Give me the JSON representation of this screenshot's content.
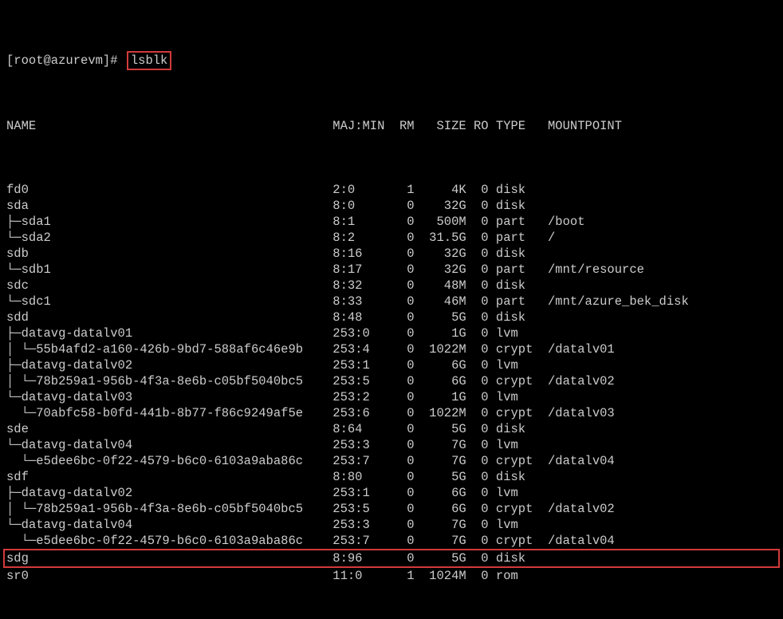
{
  "prompt_user_host": "[root@azurevm]#",
  "command": "lsblk",
  "headers": {
    "name": "NAME",
    "majmin": "MAJ:MIN",
    "rm": "RM",
    "size": "SIZE",
    "ro": "RO",
    "type": "TYPE",
    "mountpoint": "MOUNTPOINT"
  },
  "rows": [
    {
      "indent_class": "level0",
      "name": "fd0",
      "majmin": "2:0",
      "rm": "1",
      "size": "4K",
      "ro": "0",
      "type": "disk",
      "mount": ""
    },
    {
      "indent_class": "level0",
      "name": "sda",
      "majmin": "8:0",
      "rm": "0",
      "size": "32G",
      "ro": "0",
      "type": "disk",
      "mount": ""
    },
    {
      "indent_class": "level1",
      "name": "sda1",
      "majmin": "8:1",
      "rm": "0",
      "size": "500M",
      "ro": "0",
      "type": "part",
      "mount": "/boot"
    },
    {
      "indent_class": "level1-last",
      "name": "sda2",
      "majmin": "8:2",
      "rm": "0",
      "size": "31.5G",
      "ro": "0",
      "type": "part",
      "mount": "/"
    },
    {
      "indent_class": "level0",
      "name": "sdb",
      "majmin": "8:16",
      "rm": "0",
      "size": "32G",
      "ro": "0",
      "type": "disk",
      "mount": ""
    },
    {
      "indent_class": "level1-last",
      "name": "sdb1",
      "majmin": "8:17",
      "rm": "0",
      "size": "32G",
      "ro": "0",
      "type": "part",
      "mount": "/mnt/resource"
    },
    {
      "indent_class": "level0",
      "name": "sdc",
      "majmin": "8:32",
      "rm": "0",
      "size": "48M",
      "ro": "0",
      "type": "disk",
      "mount": ""
    },
    {
      "indent_class": "level1-last",
      "name": "sdc1",
      "majmin": "8:33",
      "rm": "0",
      "size": "46M",
      "ro": "0",
      "type": "part",
      "mount": "/mnt/azure_bek_disk"
    },
    {
      "indent_class": "level0",
      "name": "sdd",
      "majmin": "8:48",
      "rm": "0",
      "size": "5G",
      "ro": "0",
      "type": "disk",
      "mount": ""
    },
    {
      "indent_class": "level1",
      "name": "datavg-datalv01",
      "majmin": "253:0",
      "rm": "0",
      "size": "1G",
      "ro": "0",
      "type": "lvm",
      "mount": ""
    },
    {
      "indent_class": "level2",
      "name": "55b4afd2-a160-426b-9bd7-588af6c46e9b",
      "majmin": "253:4",
      "rm": "0",
      "size": "1022M",
      "ro": "0",
      "type": "crypt",
      "mount": "/datalv01"
    },
    {
      "indent_class": "level1",
      "name": "datavg-datalv02",
      "majmin": "253:1",
      "rm": "0",
      "size": "6G",
      "ro": "0",
      "type": "lvm",
      "mount": ""
    },
    {
      "indent_class": "level2",
      "name": "78b259a1-956b-4f3a-8e6b-c05bf5040bc5",
      "majmin": "253:5",
      "rm": "0",
      "size": "6G",
      "ro": "0",
      "type": "crypt",
      "mount": "/datalv02"
    },
    {
      "indent_class": "level1-last",
      "name": "datavg-datalv03",
      "majmin": "253:2",
      "rm": "0",
      "size": "1G",
      "ro": "0",
      "type": "lvm",
      "mount": ""
    },
    {
      "indent_class": "level2-last",
      "name": "70abfc58-b0fd-441b-8b77-f86c9249af5e",
      "majmin": "253:6",
      "rm": "0",
      "size": "1022M",
      "ro": "0",
      "type": "crypt",
      "mount": "/datalv03"
    },
    {
      "indent_class": "level0",
      "name": "sde",
      "majmin": "8:64",
      "rm": "0",
      "size": "5G",
      "ro": "0",
      "type": "disk",
      "mount": ""
    },
    {
      "indent_class": "level1-last",
      "name": "datavg-datalv04",
      "majmin": "253:3",
      "rm": "0",
      "size": "7G",
      "ro": "0",
      "type": "lvm",
      "mount": ""
    },
    {
      "indent_class": "level2-last",
      "name": "e5dee6bc-0f22-4579-b6c0-6103a9aba86c",
      "majmin": "253:7",
      "rm": "0",
      "size": "7G",
      "ro": "0",
      "type": "crypt",
      "mount": "/datalv04"
    },
    {
      "indent_class": "level0",
      "name": "sdf",
      "majmin": "8:80",
      "rm": "0",
      "size": "5G",
      "ro": "0",
      "type": "disk",
      "mount": ""
    },
    {
      "indent_class": "level1",
      "name": "datavg-datalv02",
      "majmin": "253:1",
      "rm": "0",
      "size": "6G",
      "ro": "0",
      "type": "lvm",
      "mount": ""
    },
    {
      "indent_class": "level2",
      "name": "78b259a1-956b-4f3a-8e6b-c05bf5040bc5",
      "majmin": "253:5",
      "rm": "0",
      "size": "6G",
      "ro": "0",
      "type": "crypt",
      "mount": "/datalv02"
    },
    {
      "indent_class": "level1-last",
      "name": "datavg-datalv04",
      "majmin": "253:3",
      "rm": "0",
      "size": "7G",
      "ro": "0",
      "type": "lvm",
      "mount": ""
    },
    {
      "indent_class": "level2-last",
      "name": "e5dee6bc-0f22-4579-b6c0-6103a9aba86c",
      "majmin": "253:7",
      "rm": "0",
      "size": "7G",
      "ro": "0",
      "type": "crypt",
      "mount": "/datalv04"
    },
    {
      "indent_class": "level0",
      "name": "sdg",
      "majmin": "8:96",
      "rm": "0",
      "size": "5G",
      "ro": "0",
      "type": "disk",
      "mount": "",
      "highlight": true
    },
    {
      "indent_class": "level0",
      "name": "sr0",
      "majmin": "11:0",
      "rm": "1",
      "size": "1024M",
      "ro": "0",
      "type": "rom",
      "mount": ""
    }
  ]
}
